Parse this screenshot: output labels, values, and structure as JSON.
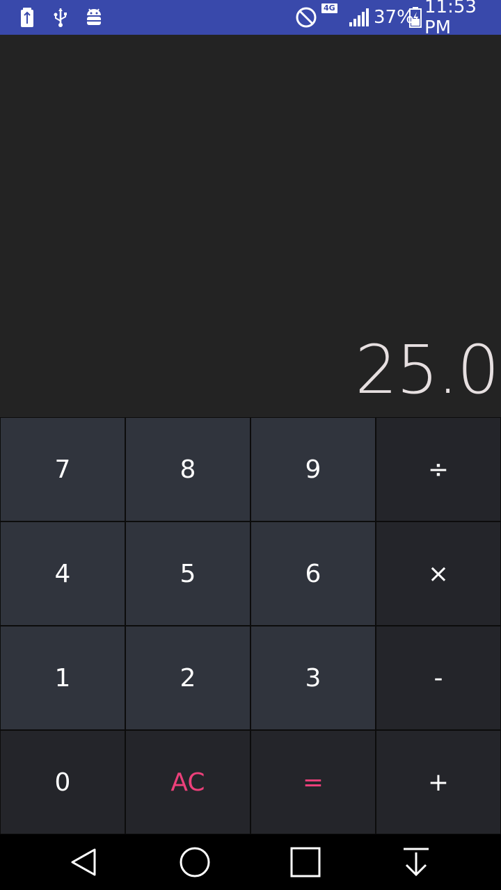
{
  "status_bar": {
    "network_badge": "4G",
    "battery_percent": "37%",
    "time": "11:53 PM",
    "background": "#3949ab",
    "icons": [
      "battery-charging-icon",
      "usb-icon",
      "android-debug-icon",
      "do-not-disturb-icon",
      "network-4g-icon",
      "signal-icon",
      "battery-icon"
    ]
  },
  "display": {
    "value": "25.0"
  },
  "keypad": {
    "rows": [
      [
        "7",
        "8",
        "9",
        "÷"
      ],
      [
        "4",
        "5",
        "6",
        "×"
      ],
      [
        "1",
        "2",
        "3",
        "-"
      ],
      [
        "0",
        "AC",
        "=",
        "+"
      ]
    ],
    "accent_color": "#ec407a"
  },
  "nav_bar": {
    "icons": [
      "back-icon",
      "home-icon",
      "recents-icon",
      "notification-drawer-icon"
    ]
  }
}
